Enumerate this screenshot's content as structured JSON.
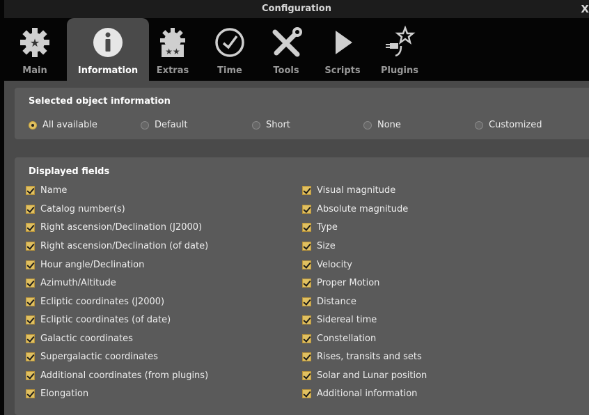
{
  "window": {
    "title": "Configuration",
    "close": "X"
  },
  "tabs": [
    {
      "label": "Main",
      "icon": "gear-star-icon"
    },
    {
      "label": "Information",
      "icon": "info-icon"
    },
    {
      "label": "Extras",
      "icon": "gear-stars-icon"
    },
    {
      "label": "Time",
      "icon": "clock-icon"
    },
    {
      "label": "Tools",
      "icon": "tools-icon"
    },
    {
      "label": "Scripts",
      "icon": "play-icon"
    },
    {
      "label": "Plugins",
      "icon": "plug-star-icon"
    }
  ],
  "selected_object": {
    "title": "Selected object information",
    "options": [
      "All available",
      "Default",
      "Short",
      "None",
      "Customized"
    ],
    "selected": "All available"
  },
  "displayed_fields": {
    "title": "Displayed fields",
    "left": [
      "Name",
      "Catalog number(s)",
      "Right ascension/Declination (J2000)",
      "Right ascension/Declination (of date)",
      "Hour angle/Declination",
      "Azimuth/Altitude",
      "Ecliptic coordinates (J2000)",
      "Ecliptic coordinates (of date)",
      "Galactic coordinates",
      "Supergalactic coordinates",
      "Additional coordinates (from plugins)",
      "Elongation"
    ],
    "right": [
      "Visual magnitude",
      "Absolute magnitude",
      "Type",
      "Size",
      "Velocity",
      "Proper Motion",
      "Distance",
      "Sidereal time",
      "Constellation",
      "Rises, transits and sets",
      "Solar and Lunar position",
      "Additional information"
    ]
  },
  "colors": {
    "accent": "#e0c060",
    "panel": "#5a5a5a",
    "background": "#4a4a4a",
    "tabbar": "#050505"
  }
}
